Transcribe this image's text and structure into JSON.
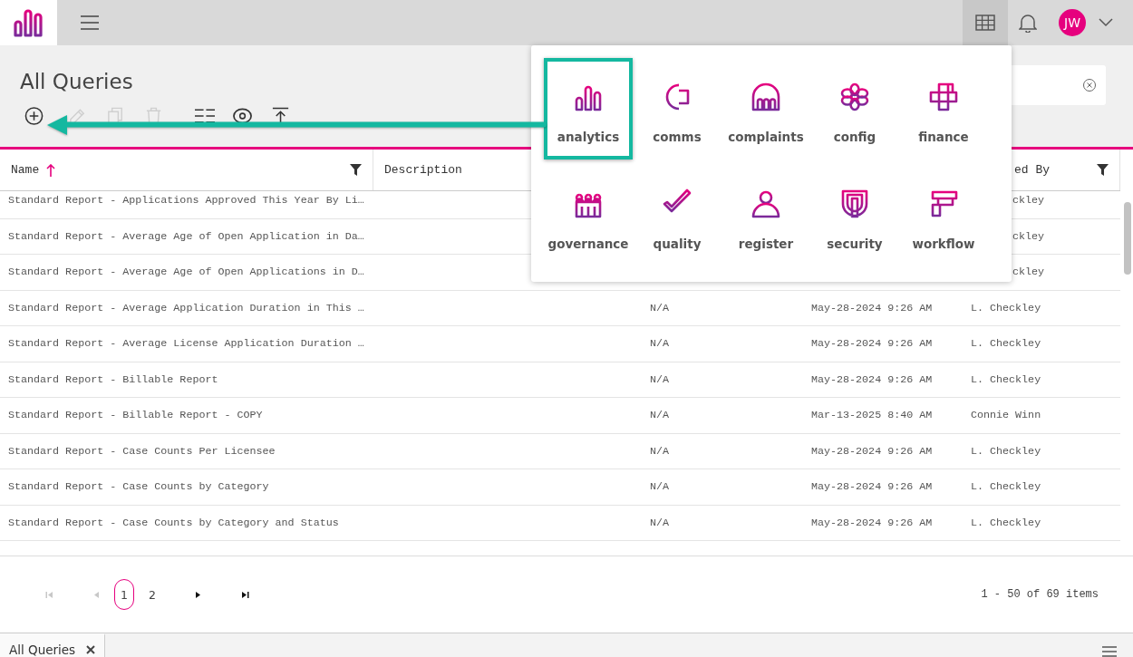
{
  "topbar": {
    "avatar_initials": "JW",
    "apps_open": true
  },
  "page": {
    "title": "All Queries",
    "toolbar": [
      {
        "kind": "add",
        "disabled": false
      },
      {
        "kind": "edit",
        "disabled": true
      },
      {
        "kind": "copy",
        "disabled": true
      },
      {
        "kind": "delete",
        "disabled": true
      },
      {
        "kind": "columns",
        "disabled": false
      },
      {
        "kind": "view",
        "disabled": false
      },
      {
        "kind": "export",
        "disabled": false
      }
    ]
  },
  "table": {
    "columns": [
      {
        "label": "Name",
        "sorted": true,
        "filter": true
      },
      {
        "label": "Description",
        "sorted": false
      },
      {
        "label": "ed By",
        "sorted": false,
        "filter": true
      }
    ],
    "rows": [
      {
        "name": "Standard Report - Applications Approved This Year By Li…",
        "column_5": "ckley",
        "partial": true
      },
      {
        "name": "Standard Report - Average Age of Open Application in Da…",
        "column_5": "ckley",
        "partial": true
      },
      {
        "name": "Standard Report - Average Age of Open Applications in D…",
        "column_5": "ckley",
        "partial": true
      },
      {
        "name": "Standard Report - Average Application Duration in This …",
        "column_3": "N/A",
        "column_4": "May-28-2024 9:26 AM",
        "column_5": "L. Checkley",
        "partial": false
      },
      {
        "name": "Standard Report - Average License Application Duration …",
        "column_3": "N/A",
        "column_4": "May-28-2024 9:26 AM",
        "column_5": "L. Checkley",
        "partial": false
      },
      {
        "name": "Standard Report - Billable Report",
        "column_3": "N/A",
        "column_4": "May-28-2024 9:26 AM",
        "column_5": "L. Checkley",
        "partial": false
      },
      {
        "name": "Standard Report - Billable Report - COPY",
        "column_3": "N/A",
        "column_4": "Mar-13-2025 8:40 AM",
        "column_5": "Connie Winn",
        "partial": false
      },
      {
        "name": "Standard Report - Case Counts Per Licensee",
        "column_3": "N/A",
        "column_4": "May-28-2024 9:26 AM",
        "column_5": "L. Checkley",
        "partial": false
      },
      {
        "name": "Standard Report - Case Counts by Category",
        "column_3": "N/A",
        "column_4": "May-28-2024 9:26 AM",
        "column_5": "L. Checkley",
        "partial": false
      },
      {
        "name": "Standard Report - Case Counts by Category and Status",
        "column_3": "N/A",
        "column_4": "May-28-2024 9:26 AM",
        "column_5": "L. Checkley",
        "partial": false
      }
    ]
  },
  "pager": {
    "first_disabled": true,
    "prev_disabled": true,
    "pages": [
      {
        "label": "1",
        "selected": true
      },
      {
        "label": "2",
        "selected": false
      }
    ],
    "summary": "1 - 50 of 69 items"
  },
  "tabs": [
    {
      "label": "All Queries",
      "selected": true
    }
  ],
  "launcher": {
    "apps": [
      {
        "label": "analytics",
        "highlighted": true
      },
      {
        "label": "comms",
        "highlighted": false
      },
      {
        "label": "complaints",
        "highlighted": false
      },
      {
        "label": "config",
        "highlighted": false
      },
      {
        "label": "finance",
        "highlighted": false
      },
      {
        "label": "governance",
        "highlighted": false
      },
      {
        "label": "quality",
        "highlighted": false
      },
      {
        "label": "register",
        "highlighted": false
      },
      {
        "label": "security",
        "highlighted": false
      },
      {
        "label": "workflow",
        "highlighted": false
      }
    ]
  }
}
